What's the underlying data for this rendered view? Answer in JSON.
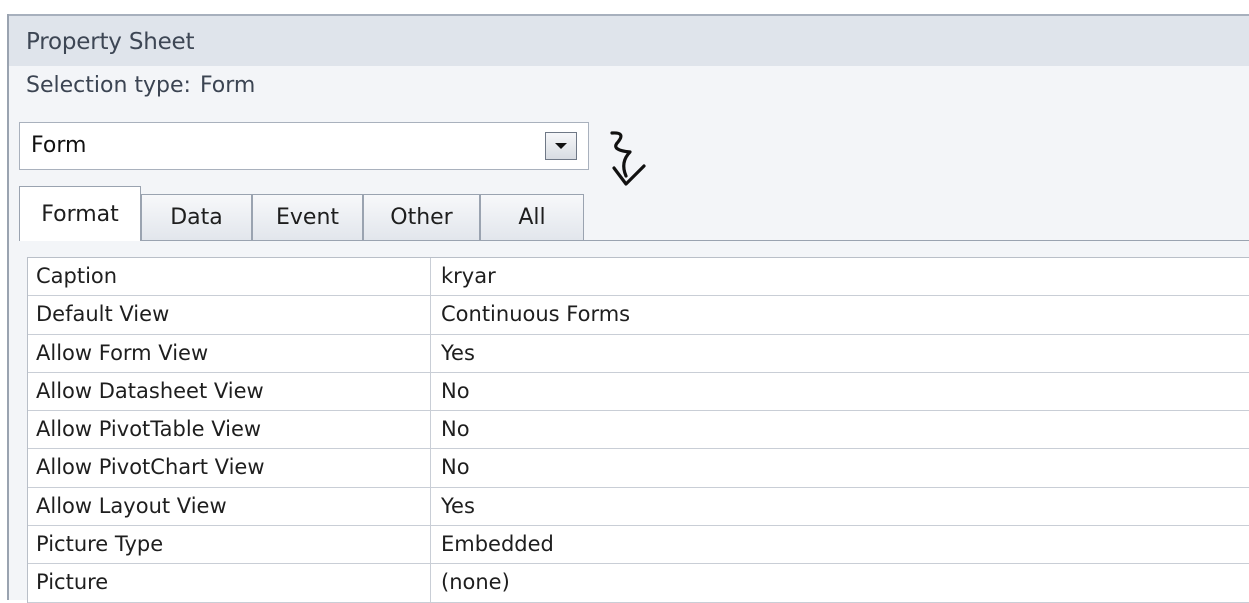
{
  "window": {
    "title": "Property Sheet",
    "selection_label": "Selection type:",
    "selection_value": "Form"
  },
  "object_combo": {
    "value": "Form",
    "dropdown_icon": "chevron-down-icon"
  },
  "tabs": [
    {
      "label": "Format",
      "active": true
    },
    {
      "label": "Data",
      "active": false
    },
    {
      "label": "Event",
      "active": false
    },
    {
      "label": "Other",
      "active": false
    },
    {
      "label": "All",
      "active": false
    }
  ],
  "properties": [
    {
      "name": "Caption",
      "value": "kryar"
    },
    {
      "name": "Default View",
      "value": "Continuous Forms"
    },
    {
      "name": "Allow Form View",
      "value": "Yes"
    },
    {
      "name": "Allow Datasheet View",
      "value": "No"
    },
    {
      "name": "Allow PivotTable View",
      "value": "No"
    },
    {
      "name": "Allow PivotChart View",
      "value": "No"
    },
    {
      "name": "Allow Layout View",
      "value": "Yes"
    },
    {
      "name": "Picture Type",
      "value": "Embedded"
    },
    {
      "name": "Picture",
      "value": "(none)"
    }
  ],
  "annotation": {
    "icon": "hand-drawn-arrow-down-icon",
    "color": "#111111"
  }
}
